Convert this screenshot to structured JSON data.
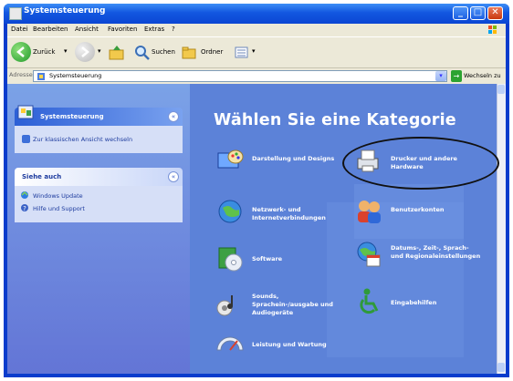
{
  "window": {
    "title": "Systemsteuerung",
    "buttons": {
      "minimize": "_",
      "maximize": "□",
      "close": "✕"
    }
  },
  "menubar": {
    "items": [
      "Datei",
      "Bearbeiten",
      "Ansicht",
      "Favoriten",
      "Extras",
      "?"
    ]
  },
  "toolbar": {
    "back_label": "Zurück",
    "search_label": "Suchen",
    "folders_label": "Ordner",
    "arrow": "▾"
  },
  "address": {
    "label": "Adresse",
    "value": "Systemsteuerung",
    "go_label": "Wechseln zu",
    "go_glyph": "→",
    "dropdown_glyph": "▾"
  },
  "sidebar": {
    "panel_title": "Systemsteuerung",
    "switch_view_link": "Zur klassischen Ansicht wechseln",
    "see_also_title": "Siehe auch",
    "see_also_links": [
      "Windows Update",
      "Hilfe und Support"
    ],
    "collapse_glyph": "«"
  },
  "main": {
    "heading": "Wählen Sie eine Kategorie",
    "categories": [
      "Darstellung und Designs",
      "Drucker und andere Hardware",
      "Netzwerk- und Internetverbindungen",
      "Benutzerkonten",
      "Software",
      "Datums-, Zeit-, Sprach- und Regionaleinstellungen",
      "Sounds, Sprachein-/ausgabe und Audiogeräte",
      "Eingabehilfen",
      "Leistung und Wartung"
    ]
  },
  "colors": {
    "title_blue": "#0b46d3",
    "side_panel": "#7ba2e7",
    "main_panel": "#5c82d8",
    "menubar": "#ece9d8"
  }
}
